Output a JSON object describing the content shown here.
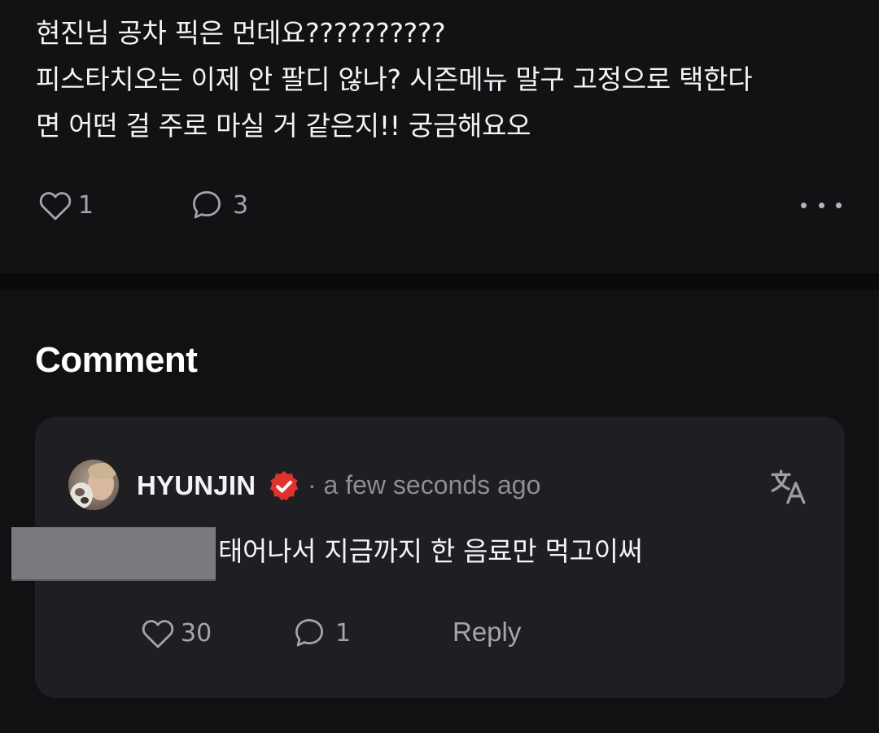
{
  "post": {
    "body": "현진님 공차 픽은 먼데요??????????\n피스타치오는 이제 안 팔디 않나? 시즌메뉴 말구 고정으로 택한다\n면 어떤 걸 주로 마실 거 같은지!! 궁금해요오",
    "like_count": "1",
    "comment_count": "3",
    "icons": {
      "like": "heart-outline-icon",
      "comment": "speech-bubble-icon",
      "more": "more-horizontal-icon"
    }
  },
  "comments_section": {
    "title": "Comment"
  },
  "comment": {
    "author": "HYUNJIN",
    "timestamp": "· a few seconds ago",
    "text": "태어나서 지금까지 한 음료만 먹고이써",
    "like_count": "30",
    "reply_count": "1",
    "reply_label": "Reply",
    "icons": {
      "verified": "verified-badge-icon",
      "translate": "translate-icon"
    }
  },
  "colors": {
    "background": "#111114",
    "card": "#1e1e23",
    "badge": "#e0322c",
    "muted_text": "#a4a4ab"
  }
}
